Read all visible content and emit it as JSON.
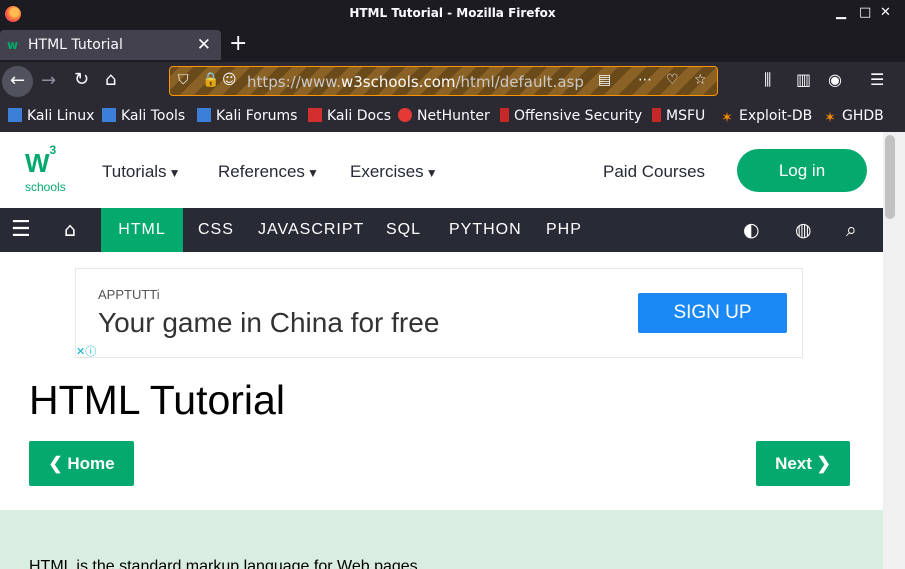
{
  "window": {
    "title": "HTML Tutorial - Mozilla Firefox"
  },
  "tab": {
    "label": "HTML Tutorial"
  },
  "url": {
    "prefix": "https://www.",
    "domain": "w3schools.com",
    "path": "/html/default.asp"
  },
  "bookmarks": [
    "Kali Linux",
    "Kali Tools",
    "Kali Forums",
    "Kali Docs",
    "NetHunter",
    "Offensive Security",
    "MSFU",
    "Exploit-DB",
    "GHDB"
  ],
  "site": {
    "logo_mark": "W",
    "logo_sup": "3",
    "logo_sub": "schools",
    "menu": [
      "Tutorials",
      "References",
      "Exercises"
    ],
    "paid": "Paid Courses",
    "login": "Log in"
  },
  "topnav": [
    "HTML",
    "CSS",
    "JAVASCRIPT",
    "SQL",
    "PYTHON",
    "PHP"
  ],
  "ad": {
    "brand": "APPTUTTi",
    "headline": "Your game in China for free",
    "cta": "SIGN UP"
  },
  "page": {
    "title": "HTML Tutorial",
    "home": "❮ Home",
    "next": "Next ❯",
    "intro": "HTML is the standard markup language for Web pages."
  },
  "colors": {
    "accent": "#04aa6d",
    "nav": "#282a35"
  }
}
